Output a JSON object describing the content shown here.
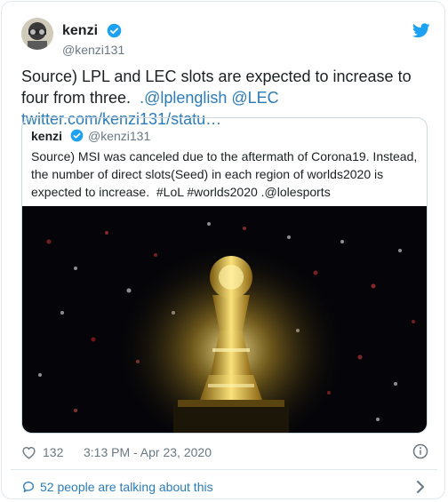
{
  "tweet": {
    "author": {
      "name": "kenzi",
      "handle": "@kenzi131"
    },
    "text_plain": "Source) LPL and LEC slots are expected to increase to four from three.",
    "mentions": ".@lplenglish @LEC",
    "url_text": "twitter.com/kenzi131/statu…",
    "likes": "132",
    "timestamp": "3:13 PM - Apr 23, 2020",
    "talking": "52 people are talking about this"
  },
  "quoted": {
    "author": {
      "name": "kenzi",
      "handle": "@kenzi131"
    },
    "text": "Source) MSI was canceled due to the aftermath of Corona19. Instead, the number of direct slots(Seed) in each region of worlds2020 is expected to increase.",
    "hashtags": "#LoL  #worlds2020",
    "mention": ".@lolesports"
  },
  "icons": [
    "verified-icon",
    "twitter-bird-icon",
    "heart-icon",
    "info-icon",
    "speech-bubble-icon",
    "chevron-right-icon"
  ],
  "colors": {
    "link": "#2b7bb9",
    "verified": "#1da1f2",
    "muted": "#697882",
    "trophy_gold": "#e8b830"
  }
}
